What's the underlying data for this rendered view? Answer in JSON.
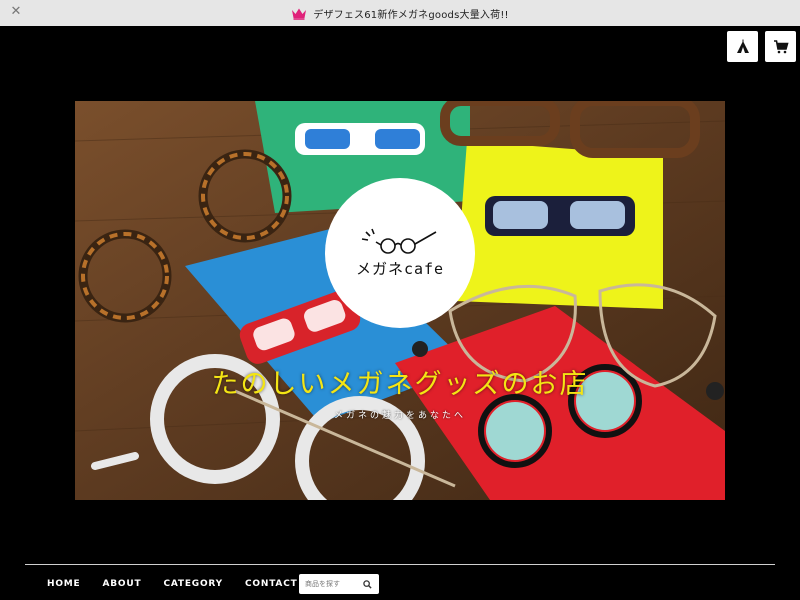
{
  "announcement": {
    "text": "デザフェス61新作メガネgoods大量入荷!!",
    "icon": "crown-icon",
    "accent": "#e0217a"
  },
  "header": {
    "store_icon": "tent-icon",
    "cart_icon": "cart-icon"
  },
  "hero": {
    "logo_text": "メガネcafe",
    "title": "たのしいメガネグッズのお店",
    "subtitle": "メガネの魅力をあなたへ",
    "title_color": "#f4e514"
  },
  "nav": {
    "items": [
      "HOME",
      "ABOUT",
      "CATEGORY",
      "CONTACT"
    ]
  },
  "search": {
    "placeholder": "商品を探す",
    "icon": "search-icon"
  }
}
